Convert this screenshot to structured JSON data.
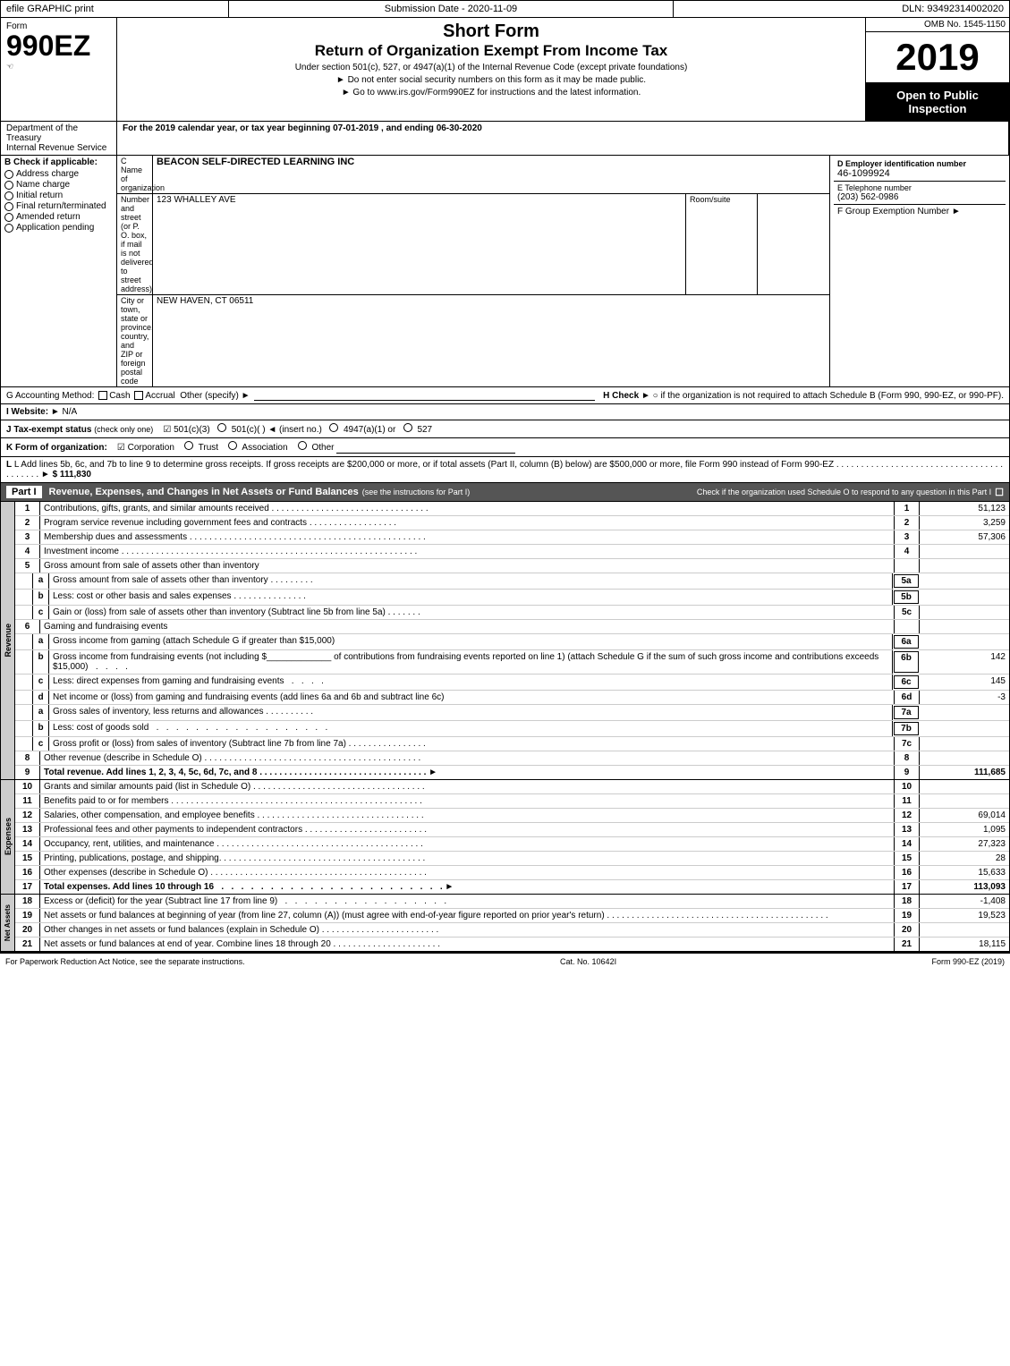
{
  "topBar": {
    "efile": "efile GRAPHIC print",
    "submission": "Submission Date - 2020-11-09",
    "dln": "DLN: 93492314002020"
  },
  "header": {
    "formLabel": "Form",
    "formNumber": "990EZ",
    "icon": "☜",
    "shortForm": "Short Form",
    "returnTitle": "Return of Organization Exempt From Income Tax",
    "underSection": "Under section 501(c), 527, or 4947(a)(1) of the Internal Revenue Code (except private foundations)",
    "doNotEnter": "► Do not enter social security numbers on this form as it may be made public.",
    "goTo": "► Go to www.irs.gov/Form990EZ for instructions and the latest information.",
    "ombNumber": "OMB No. 1545-1150",
    "year": "2019",
    "openPublic": "Open to Public Inspection"
  },
  "dept": {
    "department": "Department of the Treasury",
    "internalRevenue": "Internal Revenue Service",
    "forYear": "For the 2019 calendar year, or tax year beginning 07-01-2019 , and ending 06-30-2020"
  },
  "checkSection": {
    "checkLabel": "B Check if applicable:",
    "checks": [
      {
        "label": "Address change",
        "checked": false
      },
      {
        "label": "Name change",
        "checked": false
      },
      {
        "label": "Initial return",
        "checked": false
      },
      {
        "label": "Final return/terminated",
        "checked": false
      },
      {
        "label": "Amended return",
        "checked": false
      },
      {
        "label": "Application pending",
        "checked": false
      }
    ],
    "cLabel": "C Name of organization",
    "orgName": "BEACON SELF-DIRECTED LEARNING INC",
    "addressLabel": "Number and street (or P. O. box, if mail is not delivered to street address)",
    "addressValue": "123 WHALLEY AVE",
    "roomLabel": "Room/suite",
    "roomValue": "",
    "cityLabel": "City or town, state or province, country, and ZIP or foreign postal code",
    "cityValue": "NEW HAVEN, CT  06511",
    "dLabel": "D Employer identification number",
    "ein": "46-1099924",
    "eLabel": "E Telephone number",
    "phone": "(203) 562-0986",
    "fLabel": "F Group Exemption Number",
    "fArrow": "►"
  },
  "accountingMethod": {
    "gLabel": "G Accounting Method:",
    "cashChecked": true,
    "accrualChecked": false,
    "otherLabel": "Other (specify) ►",
    "hLabel": "H Check ►",
    "hText": "○ if the organization is not required to attach Schedule B (Form 990, 990-EZ, or 990-PF)."
  },
  "website": {
    "iLabel": "I Website: ►",
    "websiteValue": "N/A"
  },
  "taxExempt": {
    "jLabel": "J Tax-exempt status",
    "jNote": "(check only one)",
    "options": [
      "✔ 501(c)(3)",
      "○ 501(c)(  ) ◄ (insert no.)",
      "○ 4947(a)(1) or",
      "○ 527"
    ]
  },
  "formOrg": {
    "kLabel": "K Form of organization:",
    "options": [
      "✔ Corporation",
      "○ Trust",
      "○ Association",
      "○ Other"
    ]
  },
  "lineL": {
    "text": "L Add lines 5b, 6c, and 7b to line 9 to determine gross receipts. If gross receipts are $200,000 or more, or if total assets (Part II, column (B) below) are $500,000 or more, file Form 990 instead of Form 990-EZ",
    "dots": "......................................",
    "arrow": "►",
    "amount": "$ 111,830"
  },
  "partI": {
    "title": "Part I",
    "titleText": "Revenue, Expenses, and Changes in Net Assets or Fund Balances",
    "instructionNote": "(see the instructions for Part I)",
    "checkNote": "Check if the organization used Schedule O to respond to any question in this Part I",
    "rows": [
      {
        "num": "1",
        "desc": "Contributions, gifts, grants, and similar amounts received",
        "dots": true,
        "lineNum": "1",
        "amount": "51,123"
      },
      {
        "num": "2",
        "desc": "Program service revenue including government fees and contracts",
        "dots": true,
        "lineNum": "2",
        "amount": "3,259"
      },
      {
        "num": "3",
        "desc": "Membership dues and assessments",
        "dots": true,
        "lineNum": "3",
        "amount": "57,306"
      },
      {
        "num": "4",
        "desc": "Investment income",
        "dots": true,
        "lineNum": "4",
        "amount": ""
      }
    ],
    "row5": {
      "main": {
        "num": "5",
        "desc": "Gross amount from sale of assets other than inventory"
      },
      "sub": [
        {
          "letter": "a",
          "desc": "Gross amount from sale of assets other than inventory",
          "boxLabel": "5a",
          "amount": ""
        },
        {
          "letter": "b",
          "desc": "Less: cost or other basis and sales expenses",
          "boxLabel": "5b",
          "amount": ""
        },
        {
          "letter": "c",
          "desc": "Gain or (loss) from sale of assets other than inventory (Subtract line 5b from line 5a)",
          "dots": true,
          "lineNum": "5c",
          "amount": ""
        }
      ]
    },
    "row6": {
      "main": {
        "num": "6",
        "desc": "Gaming and fundraising events"
      },
      "sub": [
        {
          "letter": "a",
          "desc": "Gross income from gaming (attach Schedule G if greater than $15,000)",
          "boxLabel": "6a",
          "amount": ""
        },
        {
          "letter": "b",
          "desc": "Gross income from fundraising events (not including $_____________ of contributions from fundraising events reported on line 1) (attach Schedule G if the sum of such gross income and contributions exceeds $15,000)",
          "boxLabel": "6b",
          "amount": "142"
        },
        {
          "letter": "c",
          "desc": "Less: direct expenses from gaming and fundraising events",
          "boxLabel": "6c",
          "amount": "145"
        },
        {
          "letter": "d",
          "desc": "Net income or (loss) from gaming and fundraising events (add lines 6a and 6b and subtract line 6c)",
          "lineNum": "6d",
          "amount": "-3"
        }
      ]
    },
    "row7": {
      "sub": [
        {
          "letter": "a",
          "desc": "Gross sales of inventory, less returns and allowances",
          "dots": true,
          "boxLabel": "7a",
          "amount": ""
        },
        {
          "letter": "b",
          "desc": "Less: cost of goods sold",
          "dots": true,
          "boxLabel": "7b",
          "amount": ""
        },
        {
          "letter": "c",
          "desc": "Gross profit or (loss) from sales of inventory (Subtract line 7b from line 7a)",
          "dots": true,
          "lineNum": "7c",
          "amount": ""
        }
      ]
    },
    "rows2": [
      {
        "num": "8",
        "desc": "Other revenue (describe in Schedule O)",
        "dots": true,
        "lineNum": "8",
        "amount": ""
      },
      {
        "num": "9",
        "desc": "Total revenue. Add lines 1, 2, 3, 4, 5c, 6d, 7c, and 8",
        "dots": true,
        "lineNum": "9",
        "amount": "111,685",
        "bold": true,
        "arrow": true
      }
    ]
  },
  "expenses": {
    "rows": [
      {
        "num": "10",
        "desc": "Grants and similar amounts paid (list in Schedule O)",
        "dots": true,
        "lineNum": "10",
        "amount": ""
      },
      {
        "num": "11",
        "desc": "Benefits paid to or for members",
        "dots": true,
        "lineNum": "11",
        "amount": ""
      },
      {
        "num": "12",
        "desc": "Salaries, other compensation, and employee benefits",
        "dots": true,
        "lineNum": "12",
        "amount": "69,014"
      },
      {
        "num": "13",
        "desc": "Professional fees and other payments to independent contractors",
        "dots": true,
        "lineNum": "13",
        "amount": "1,095"
      },
      {
        "num": "14",
        "desc": "Occupancy, rent, utilities, and maintenance",
        "dots": true,
        "lineNum": "14",
        "amount": "27,323"
      },
      {
        "num": "15",
        "desc": "Printing, publications, postage, and shipping.",
        "dots": true,
        "lineNum": "15",
        "amount": "28"
      },
      {
        "num": "16",
        "desc": "Other expenses (describe in Schedule O)",
        "dots": true,
        "lineNum": "16",
        "amount": "15,633"
      },
      {
        "num": "17",
        "desc": "Total expenses. Add lines 10 through 16",
        "dots": true,
        "lineNum": "17",
        "amount": "113,093",
        "bold": true,
        "arrow": true
      }
    ]
  },
  "netAssets": {
    "rows": [
      {
        "num": "18",
        "desc": "Excess or (deficit) for the year (Subtract line 17 from line 9)",
        "dots": true,
        "lineNum": "18",
        "amount": "-1,408"
      },
      {
        "num": "19",
        "desc": "Net assets or fund balances at beginning of year (from line 27, column (A)) (must agree with end-of-year figure reported on prior year's return)",
        "dots": true,
        "lineNum": "19",
        "amount": "19,523"
      },
      {
        "num": "20",
        "desc": "Other changes in net assets or fund balances (explain in Schedule O)",
        "dots": true,
        "lineNum": "20",
        "amount": ""
      },
      {
        "num": "21",
        "desc": "Net assets or fund balances at end of year. Combine lines 18 through 20",
        "dots": true,
        "lineNum": "21",
        "amount": "18,115"
      }
    ]
  },
  "footer": {
    "paperwork": "For Paperwork Reduction Act Notice, see the separate instructions.",
    "catNo": "Cat. No. 10642I",
    "formLabel": "Form 990-EZ (2019)"
  }
}
